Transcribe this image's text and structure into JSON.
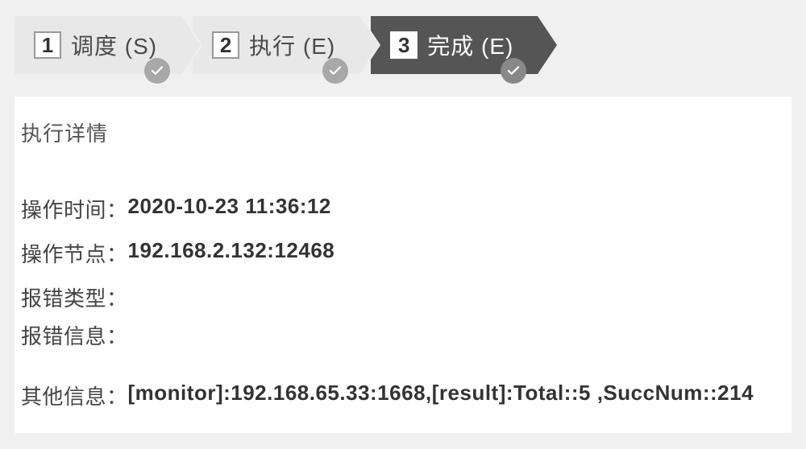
{
  "steps": [
    {
      "num": "1",
      "label": "调度 (S)",
      "active": false
    },
    {
      "num": "2",
      "label": "执行 (E)",
      "active": false
    },
    {
      "num": "3",
      "label": "完成 (E)",
      "active": true
    }
  ],
  "content": {
    "title": "执行详情",
    "rows": {
      "op_time_label": "操作时间：",
      "op_time_value": "2020-10-23 11:36:12",
      "op_node_label": "操作节点：",
      "op_node_value": "192.168.2.132:12468",
      "err_type_label": "报错类型：",
      "err_type_value": "",
      "err_info_label": "报错信息：",
      "err_info_value": "",
      "other_label": "其他信息：",
      "other_value": "[monitor]:192.168.65.33:1668,[result]:Total::5 ,SuccNum::214"
    }
  }
}
